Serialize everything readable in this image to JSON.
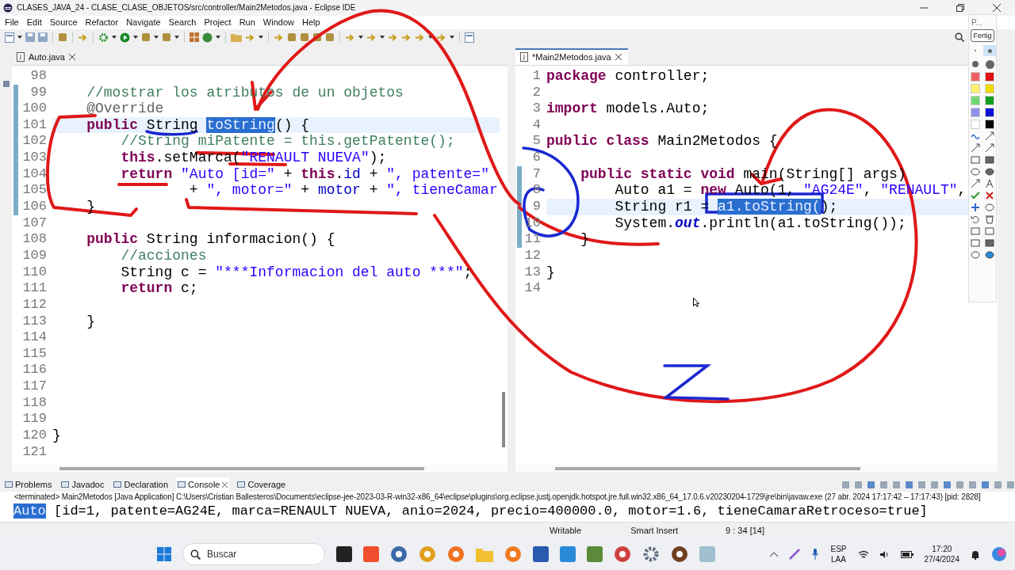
{
  "window": {
    "title": "CLASES_JAVA_24 - CLASE_CLASE_OBJETOS/src/controller/Main2Metodos.java - Eclipse IDE"
  },
  "menu": [
    "File",
    "Edit",
    "Source",
    "Refactor",
    "Navigate",
    "Search",
    "Project",
    "Run",
    "Window",
    "Help"
  ],
  "editors": [
    {
      "tab": {
        "label": "Auto.java",
        "selected": false
      },
      "lines": [
        {
          "num": "98",
          "current": false,
          "changed": false
        },
        {
          "num": "99",
          "current": false,
          "changed": true,
          "tokens": [
            {
              "text": "    //mostrar los atributos de un objetos",
              "kind": "comment"
            }
          ]
        },
        {
          "num": "100",
          "current": false,
          "changed": true,
          "tokens": [
            {
              "text": "    @Override",
              "kind": "annotation"
            }
          ]
        },
        {
          "num": "101",
          "current": true,
          "changed": true,
          "tokens": [
            {
              "text": "    public",
              "kind": "keyword"
            },
            {
              "text": " String ",
              "kind": "plain"
            },
            {
              "text": "toString",
              "kind": "selection"
            },
            {
              "text": "() {",
              "kind": "plain"
            }
          ]
        },
        {
          "num": "102",
          "current": false,
          "changed": true,
          "tokens": [
            {
              "text": "        //String miPatente = this.getPatente();",
              "kind": "comment"
            }
          ]
        },
        {
          "num": "103",
          "current": false,
          "changed": true,
          "tokens": [
            {
              "text": "        this",
              "kind": "keyword"
            },
            {
              "text": ".setMarca(",
              "kind": "plain"
            },
            {
              "text": "\"RENAULT NUEVA\"",
              "kind": "string"
            },
            {
              "text": ");",
              "kind": "plain"
            }
          ]
        },
        {
          "num": "104",
          "current": false,
          "changed": true,
          "tokens": [
            {
              "text": "        return",
              "kind": "keyword"
            },
            {
              "text": " \"Auto [id=\"",
              "kind": "string"
            },
            {
              "text": " + ",
              "kind": "plain"
            },
            {
              "text": "this",
              "kind": "keyword"
            },
            {
              "text": ".",
              "kind": "plain"
            },
            {
              "text": "id",
              "kind": "field"
            },
            {
              "text": " + ",
              "kind": "plain"
            },
            {
              "text": "\", patente=\"",
              "kind": "string"
            }
          ]
        },
        {
          "num": "105",
          "current": false,
          "changed": true,
          "tokens": [
            {
              "text": "                + ",
              "kind": "plain"
            },
            {
              "text": "\", motor=\"",
              "kind": "string"
            },
            {
              "text": " + ",
              "kind": "plain"
            },
            {
              "text": "motor",
              "kind": "field"
            },
            {
              "text": " + ",
              "kind": "plain"
            },
            {
              "text": "\", tieneCamar",
              "kind": "string"
            }
          ]
        },
        {
          "num": "106",
          "current": false,
          "changed": true,
          "tokens": [
            {
              "text": "    }",
              "kind": "plain"
            }
          ]
        },
        {
          "num": "107",
          "current": false,
          "changed": false
        },
        {
          "num": "108",
          "current": false,
          "changed": false,
          "tokens": [
            {
              "text": "    public",
              "kind": "keyword"
            },
            {
              "text": " String informacion() {",
              "kind": "plain"
            }
          ]
        },
        {
          "num": "109",
          "current": false,
          "changed": false,
          "tokens": [
            {
              "text": "        //acciones",
              "kind": "comment"
            }
          ]
        },
        {
          "num": "110",
          "current": false,
          "changed": false,
          "tokens": [
            {
              "text": "        String c = ",
              "kind": "plain"
            },
            {
              "text": "\"***Informacion del auto ***\"",
              "kind": "string"
            },
            {
              "text": ";",
              "kind": "plain"
            }
          ]
        },
        {
          "num": "111",
          "current": false,
          "changed": false,
          "tokens": [
            {
              "text": "        return",
              "kind": "keyword"
            },
            {
              "text": " c;",
              "kind": "plain"
            }
          ]
        },
        {
          "num": "112",
          "current": false,
          "changed": false
        },
        {
          "num": "113",
          "current": false,
          "changed": false,
          "tokens": [
            {
              "text": "    }",
              "kind": "plain"
            }
          ]
        },
        {
          "num": "114",
          "current": false,
          "changed": false
        },
        {
          "num": "115",
          "current": false,
          "changed": false
        },
        {
          "num": "116",
          "current": false,
          "changed": false
        },
        {
          "num": "117",
          "current": false,
          "changed": false
        },
        {
          "num": "118",
          "current": false,
          "changed": false
        },
        {
          "num": "119",
          "current": false,
          "changed": false
        },
        {
          "num": "120",
          "current": false,
          "changed": false,
          "tokens": [
            {
              "text": "}",
              "kind": "plain"
            }
          ]
        },
        {
          "num": "121",
          "current": false,
          "changed": false
        }
      ]
    },
    {
      "tab": {
        "label": "*Main2Metodos.java",
        "selected": true
      },
      "lines": [
        {
          "num": "1",
          "current": false,
          "changed": false,
          "tokens": [
            {
              "text": "package",
              "kind": "keyword"
            },
            {
              "text": " controller;",
              "kind": "plain"
            }
          ]
        },
        {
          "num": "2",
          "current": false,
          "changed": false
        },
        {
          "num": "3",
          "current": false,
          "changed": false,
          "tokens": [
            {
              "text": "import",
              "kind": "keyword"
            },
            {
              "text": " models.Auto;",
              "kind": "plain"
            }
          ]
        },
        {
          "num": "4",
          "current": false,
          "changed": false
        },
        {
          "num": "5",
          "current": false,
          "changed": false,
          "tokens": [
            {
              "text": "public class",
              "kind": "keyword"
            },
            {
              "text": " Main2Metodos {",
              "kind": "plain"
            }
          ]
        },
        {
          "num": "6",
          "current": false,
          "changed": false
        },
        {
          "num": "7",
          "current": false,
          "changed": true,
          "tokens": [
            {
              "text": "    public static void",
              "kind": "keyword"
            },
            {
              "text": " main(String[] args)",
              "kind": "plain"
            }
          ]
        },
        {
          "num": "8",
          "current": false,
          "changed": true,
          "tokens": [
            {
              "text": "        Auto a1 = ",
              "kind": "plain"
            },
            {
              "text": "new",
              "kind": "keyword"
            },
            {
              "text": " Auto(1, ",
              "kind": "plain"
            },
            {
              "text": "\"AG24E\"",
              "kind": "string"
            },
            {
              "text": ", ",
              "kind": "plain"
            },
            {
              "text": "\"RENAULT\"",
              "kind": "string"
            },
            {
              "text": ",",
              "kind": "plain"
            }
          ]
        },
        {
          "num": "9",
          "current": true,
          "changed": true,
          "tokens": [
            {
              "text": "        String r1 = ",
              "kind": "plain"
            },
            {
              "text": "a1.toString(",
              "kind": "selection"
            },
            {
              "text": ");",
              "kind": "plain"
            }
          ]
        },
        {
          "num": "10",
          "current": false,
          "changed": true,
          "tokens": [
            {
              "text": "        System.",
              "kind": "plain"
            },
            {
              "text": "out",
              "kind": "static"
            },
            {
              "text": ".println(a1.toString());",
              "kind": "plain"
            }
          ]
        },
        {
          "num": "11",
          "current": false,
          "changed": true,
          "tokens": [
            {
              "text": "    }",
              "kind": "plain"
            }
          ]
        },
        {
          "num": "12",
          "current": false,
          "changed": false
        },
        {
          "num": "13",
          "current": false,
          "changed": false,
          "tokens": [
            {
              "text": "}",
              "kind": "plain"
            }
          ]
        },
        {
          "num": "14",
          "current": false,
          "changed": false
        }
      ]
    }
  ],
  "bottom_tabs": [
    {
      "label": "Problems",
      "selected": false
    },
    {
      "label": "Javadoc",
      "selected": false
    },
    {
      "label": "Declaration",
      "selected": false
    },
    {
      "label": "Console",
      "selected": true
    },
    {
      "label": "Coverage",
      "selected": false
    }
  ],
  "console": {
    "header": "<terminated> Main2Metodos [Java Application] C:\\Users\\Cristian Ballesteros\\Documents\\eclipse-jee-2023-03-R-win32-x86_64\\eclipse\\plugins\\org.eclipse.justj.openjdk.hotspot.jre.full.win32.x86_64_17.0.6.v20230204-1729\\jre\\bin\\javaw.exe  (27 abr. 2024 17:17:42 – 17:17:43) [pid: 2828]",
    "output": [
      {
        "text": "Auto",
        "kind": "selection"
      },
      {
        "text": " [id=1, patente=AG24E, marca=RENAULT NUEVA, anio=2024, precio=400000.0, motor=1.6, tieneCamaraRetroceso=true]",
        "kind": "plain"
      }
    ]
  },
  "status_bar": [
    "Writable",
    "Smart Insert",
    "9 : 34 [14]"
  ],
  "palette": {
    "title": "P...",
    "button": "Fertig",
    "pen_sizes": [
      {
        "selected": false
      },
      {
        "selected": true
      },
      {
        "selected": false
      },
      {
        "selected": false
      }
    ],
    "swatches": [
      {
        "color": "#f06060"
      },
      {
        "color": "#e01010"
      },
      {
        "color": "#fff070"
      },
      {
        "color": "#f0d800"
      },
      {
        "color": "#70d870"
      },
      {
        "color": "#10a020"
      },
      {
        "color": "#9090e8"
      },
      {
        "color": "#1010d8"
      },
      {
        "color": "#ffffff"
      },
      {
        "color": "#000000"
      }
    ]
  },
  "taskbar": {
    "search_placeholder": "Buscar",
    "language": "ESP",
    "layout": "LAA",
    "time": "17:20",
    "date": "27/4/2024"
  }
}
